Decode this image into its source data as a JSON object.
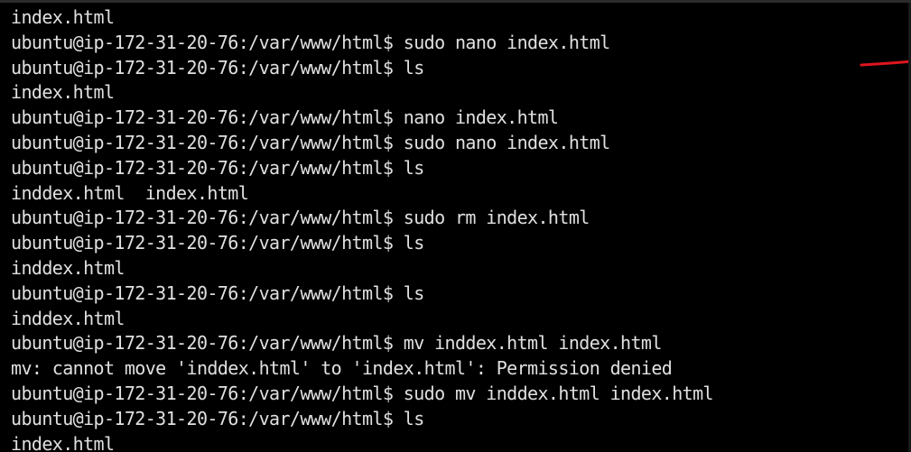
{
  "terminal": {
    "lines": [
      "index.html",
      "ubuntu@ip-172-31-20-76:/var/www/html$ sudo nano index.html",
      "ubuntu@ip-172-31-20-76:/var/www/html$ ls",
      "index.html",
      "ubuntu@ip-172-31-20-76:/var/www/html$ nano index.html",
      "ubuntu@ip-172-31-20-76:/var/www/html$ sudo nano index.html",
      "ubuntu@ip-172-31-20-76:/var/www/html$ ls",
      "inddex.html  index.html",
      "ubuntu@ip-172-31-20-76:/var/www/html$ sudo rm index.html",
      "ubuntu@ip-172-31-20-76:/var/www/html$ ls",
      "inddex.html",
      "ubuntu@ip-172-31-20-76:/var/www/html$ ls",
      "inddex.html",
      "ubuntu@ip-172-31-20-76:/var/www/html$ mv inddex.html index.html",
      "mv: cannot move 'inddex.html' to 'index.html': Permission denied",
      "ubuntu@ip-172-31-20-76:/var/www/html$ sudo mv inddex.html index.html",
      "ubuntu@ip-172-31-20-76:/var/www/html$ ls",
      "index.html"
    ]
  },
  "colors": {
    "background": "#000000",
    "text": "#e0e0e0",
    "annotation": "#e0151f"
  }
}
